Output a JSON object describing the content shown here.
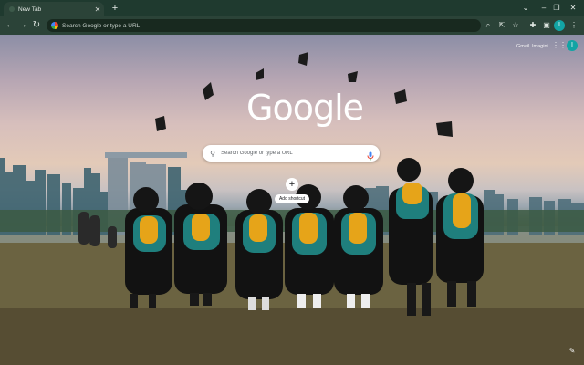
{
  "tab": {
    "title": "New Tab",
    "close": "✕"
  },
  "tabstrip": {
    "new_tab": "+",
    "minimize": "⌄",
    "restore": "–",
    "maximize": "❐",
    "close": "✕"
  },
  "toolbar": {
    "back": "←",
    "forward": "→",
    "reload": "↻",
    "omnibox_text": "Search Google or type a URL",
    "icons": {
      "zoom": "search-icon",
      "share": "share-icon",
      "bookmark": "star-icon",
      "extensions": "puzzle-icon",
      "sidepanel": "sidepanel-icon",
      "menu": "kebab-menu-icon"
    },
    "zoom_glyph": "⌕",
    "share_glyph": "⇱",
    "bookmark_glyph": "☆",
    "extensions_glyph": "✚",
    "sidepanel_glyph": "▣",
    "menu_glyph": "⋮",
    "profile_initial": "I"
  },
  "ntp": {
    "links": {
      "gmail": "Gmail",
      "images": "Imagini"
    },
    "apps_glyph": "⋮⋮",
    "avatar_initial": "I",
    "logo": "Google",
    "search_placeholder": "Search Google or type a URL",
    "shortcut_add": "+",
    "shortcut_label": "Add shortcut",
    "customize_glyph": "✎"
  },
  "colors": {
    "tabstrip": "#1f3a2f",
    "toolbar": "#2b4338",
    "omnibox": "#18291f",
    "avatar": "#12a4a4"
  }
}
